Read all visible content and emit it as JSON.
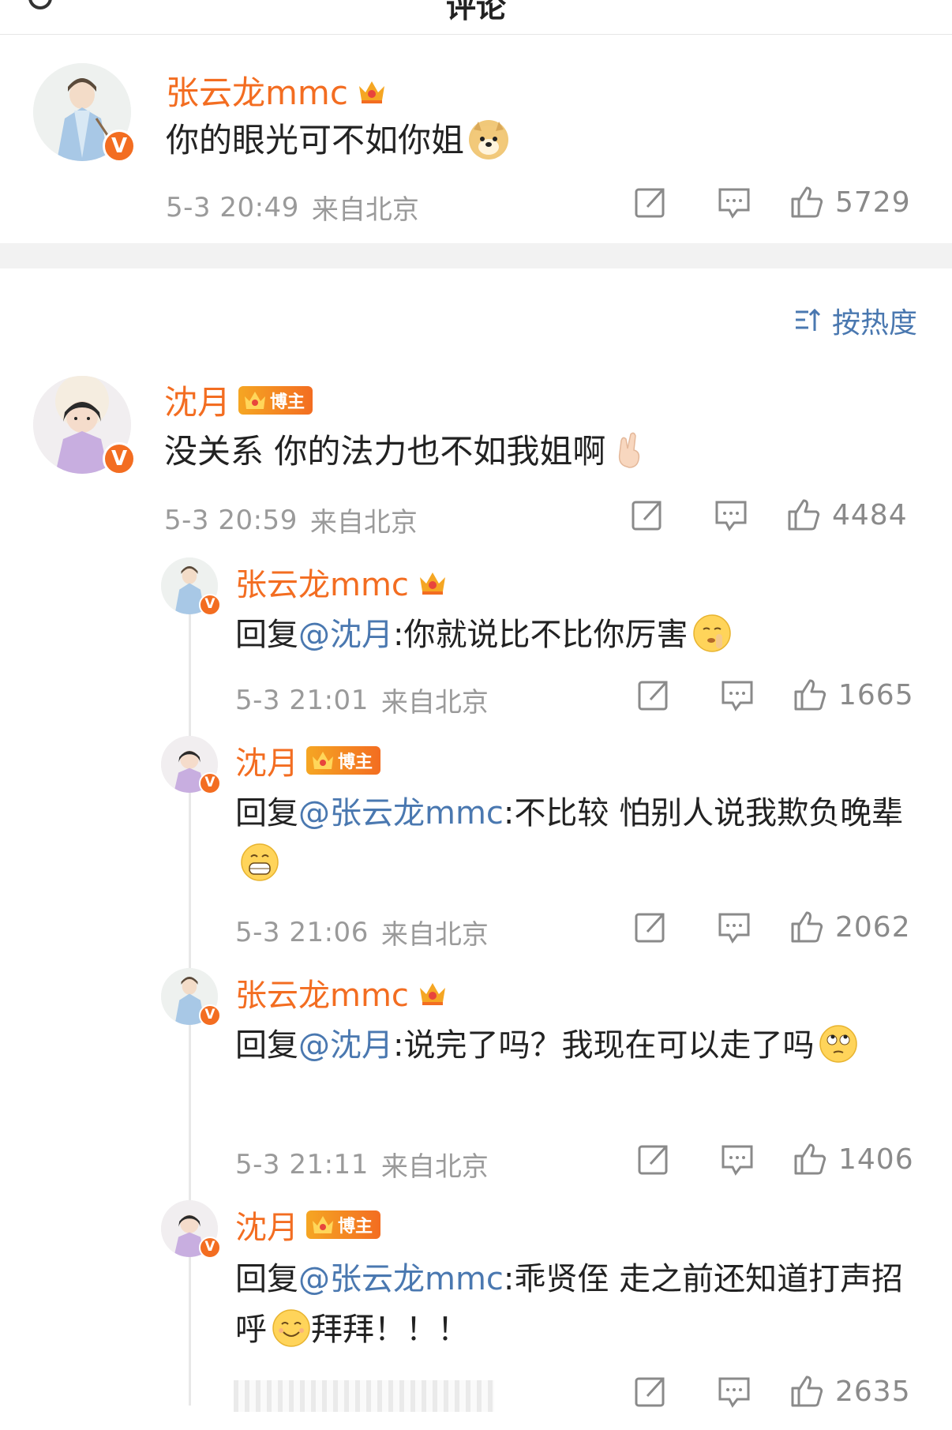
{
  "header": {
    "title": "评论"
  },
  "sort": {
    "label": "按热度"
  },
  "top_comment": {
    "user": "张云龙mmc",
    "text": "你的眼光可不如你姐",
    "emoji": "doge",
    "time": "5-3 20:49",
    "location": "来自北京",
    "likes": "5729"
  },
  "main_comment": {
    "user": "沈月",
    "tag": "博主",
    "text": "没关系 你的法力也不如我姐啊",
    "emoji": "crossed-fingers",
    "time": "5-3 20:59",
    "location": "来自北京",
    "likes": "4484"
  },
  "replies": [
    {
      "user": "张云龙mmc",
      "prefix": "回复",
      "mention": "@沈月",
      "text": ":你就说比不比你厉害",
      "emoji": "shush",
      "time": "5-3 21:01",
      "location": "来自北京",
      "likes": "1665"
    },
    {
      "user": "沈月",
      "tag": "博主",
      "prefix": "回复",
      "mention": "@张云龙mmc",
      "text": ":不比较 怕别人说我欺负晚辈",
      "emoji": "grin",
      "time": "5-3 21:06",
      "location": "来自北京",
      "likes": "2062"
    },
    {
      "user": "张云龙mmc",
      "prefix": "回复",
      "mention": "@沈月",
      "text": ":说完了吗？我现在可以走了吗",
      "emoji": "eye-roll",
      "time": "5-3 21:11",
      "location": "来自北京",
      "likes": "1406"
    },
    {
      "user": "沈月",
      "tag": "博主",
      "prefix": "回复",
      "mention": "@张云龙mmc",
      "text": ":乖贤侄 走之前还知道打声招呼",
      "text_after": "拜拜！！！",
      "emoji": "smile",
      "time": "",
      "location": "",
      "likes": "2635"
    }
  ],
  "colors": {
    "accent": "#f36d21",
    "link": "#4a78b0",
    "meta": "#9a9a9a"
  }
}
